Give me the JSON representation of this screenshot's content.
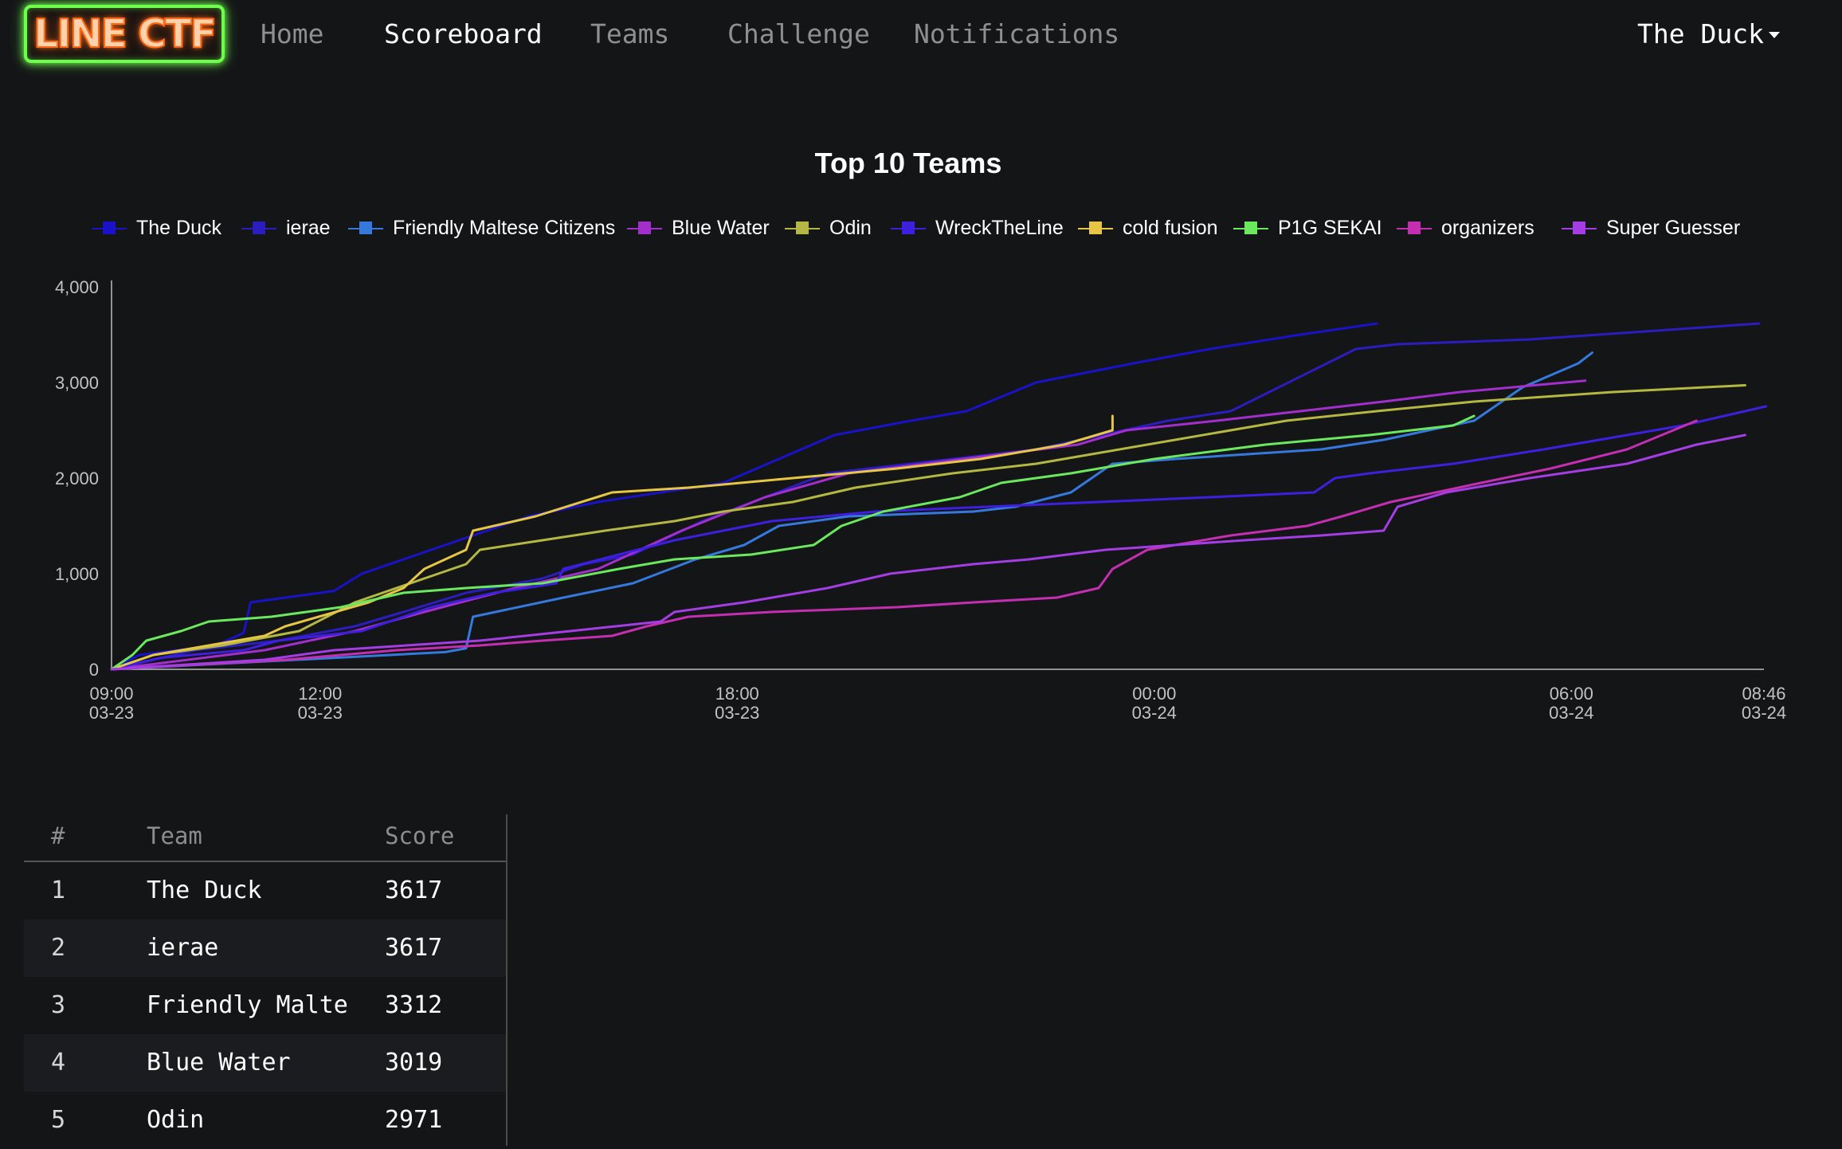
{
  "logo": {
    "text": "LINE CTF"
  },
  "nav": {
    "items": [
      {
        "label": "Home",
        "active": false
      },
      {
        "label": "Scoreboard",
        "active": true
      },
      {
        "label": "Teams",
        "active": false
      },
      {
        "label": "Challenge",
        "active": false
      },
      {
        "label": "Notifications",
        "active": false
      }
    ],
    "user": "The Duck"
  },
  "chart_data": {
    "type": "line",
    "title": "Top 10 Teams",
    "xlabel": "",
    "ylabel": "",
    "ylim": [
      0,
      4000
    ],
    "yticks": [
      "0",
      "1,000",
      "2,000",
      "3,000",
      "4,000"
    ],
    "xlim": [
      "03-23 09:00",
      "03-24 08:46"
    ],
    "xticks": [
      {
        "time": "09:00",
        "date": "03-23",
        "h": 0
      },
      {
        "time": "12:00",
        "date": "03-23",
        "h": 3
      },
      {
        "time": "18:00",
        "date": "03-23",
        "h": 9
      },
      {
        "time": "00:00",
        "date": "03-24",
        "h": 15
      },
      {
        "time": "06:00",
        "date": "03-24",
        "h": 21
      },
      {
        "time": "08:46",
        "date": "03-24",
        "h": 23.77
      }
    ],
    "legend_position": "top-center",
    "grid": false,
    "series": [
      {
        "name": "The Duck",
        "color": "#1a12c8",
        "points": [
          [
            0,
            0
          ],
          [
            0.4,
            150
          ],
          [
            1.5,
            250
          ],
          [
            1.9,
            380
          ],
          [
            2,
            700
          ],
          [
            3.2,
            820
          ],
          [
            3.6,
            1000
          ],
          [
            4.8,
            1300
          ],
          [
            6,
            1600
          ],
          [
            7,
            1750
          ],
          [
            8.8,
            1950
          ],
          [
            9.6,
            2200
          ],
          [
            10.4,
            2450
          ],
          [
            11.5,
            2600
          ],
          [
            12.3,
            2700
          ],
          [
            13.3,
            3000
          ],
          [
            14.7,
            3200
          ],
          [
            15.8,
            3350
          ],
          [
            17.1,
            3500
          ],
          [
            18.2,
            3617
          ]
        ]
      },
      {
        "name": "ierae",
        "color": "#2c1dc0",
        "points": [
          [
            0,
            0
          ],
          [
            1.2,
            200
          ],
          [
            2.4,
            300
          ],
          [
            3.5,
            450
          ],
          [
            4.2,
            600
          ],
          [
            5.1,
            800
          ],
          [
            6.2,
            950
          ],
          [
            6.8,
            1100
          ],
          [
            7.5,
            1200
          ],
          [
            8.5,
            1550
          ],
          [
            9.4,
            1800
          ],
          [
            10.3,
            2050
          ],
          [
            13.3,
            2300
          ],
          [
            15.2,
            2600
          ],
          [
            16.1,
            2700
          ],
          [
            17.9,
            3350
          ],
          [
            18.5,
            3400
          ],
          [
            20.4,
            3450
          ],
          [
            23.7,
            3617
          ]
        ]
      },
      {
        "name": "Friendly Maltese Citizens",
        "color": "#3579dc",
        "points": [
          [
            0,
            0
          ],
          [
            4.8,
            180
          ],
          [
            5.1,
            220
          ],
          [
            5.2,
            550
          ],
          [
            6.5,
            750
          ],
          [
            7.5,
            900
          ],
          [
            8.4,
            1150
          ],
          [
            9.1,
            1300
          ],
          [
            9.6,
            1500
          ],
          [
            10.6,
            1600
          ],
          [
            12.4,
            1650
          ],
          [
            13,
            1700
          ],
          [
            13.8,
            1850
          ],
          [
            14.4,
            2150
          ],
          [
            15.3,
            2200
          ],
          [
            17.4,
            2300
          ],
          [
            18.3,
            2400
          ],
          [
            19.6,
            2600
          ],
          [
            19.8,
            2700
          ],
          [
            20.3,
            2950
          ],
          [
            21.1,
            3200
          ],
          [
            21.3,
            3312
          ]
        ]
      },
      {
        "name": "Blue Water",
        "color": "#a22fcc",
        "points": [
          [
            0,
            0
          ],
          [
            2.2,
            200
          ],
          [
            3.5,
            400
          ],
          [
            4.5,
            600
          ],
          [
            5.8,
            850
          ],
          [
            7,
            1050
          ],
          [
            8.2,
            1450
          ],
          [
            9.4,
            1800
          ],
          [
            10.6,
            2050
          ],
          [
            11.7,
            2150
          ],
          [
            12.8,
            2250
          ],
          [
            13.9,
            2350
          ],
          [
            14.6,
            2500
          ],
          [
            15.9,
            2600
          ],
          [
            17.1,
            2700
          ],
          [
            18.3,
            2800
          ],
          [
            19.4,
            2900
          ],
          [
            21.2,
            3019
          ]
        ]
      },
      {
        "name": "Odin",
        "color": "#b4b842",
        "points": [
          [
            0,
            0
          ],
          [
            0.6,
            150
          ],
          [
            1.6,
            250
          ],
          [
            2.7,
            400
          ],
          [
            3.5,
            700
          ],
          [
            5.1,
            1100
          ],
          [
            5.3,
            1250
          ],
          [
            6.2,
            1350
          ],
          [
            7.1,
            1450
          ],
          [
            8.1,
            1550
          ],
          [
            8.8,
            1650
          ],
          [
            9.8,
            1750
          ],
          [
            10.7,
            1900
          ],
          [
            12.1,
            2050
          ],
          [
            13.3,
            2150
          ],
          [
            14.1,
            2250
          ],
          [
            15.3,
            2400
          ],
          [
            16.9,
            2600
          ],
          [
            18.2,
            2700
          ],
          [
            19.6,
            2800
          ],
          [
            21.6,
            2900
          ],
          [
            23.5,
            2971
          ]
        ]
      },
      {
        "name": "WreckTheLine",
        "color": "#3f1fdf",
        "points": [
          [
            0,
            0
          ],
          [
            0.7,
            120
          ],
          [
            1.9,
            200
          ],
          [
            2.4,
            300
          ],
          [
            3.6,
            400
          ],
          [
            4.6,
            650
          ],
          [
            5.5,
            800
          ],
          [
            6.4,
            900
          ],
          [
            6.5,
            1050
          ],
          [
            7.3,
            1200
          ],
          [
            8.1,
            1350
          ],
          [
            9.5,
            1550
          ],
          [
            11,
            1650
          ],
          [
            12.6,
            1700
          ],
          [
            14.2,
            1750
          ],
          [
            15.8,
            1800
          ],
          [
            17.3,
            1850
          ],
          [
            17.6,
            2000
          ],
          [
            18.1,
            2050
          ],
          [
            19.3,
            2150
          ],
          [
            20.6,
            2300
          ],
          [
            21.8,
            2450
          ],
          [
            22.6,
            2550
          ],
          [
            23.8,
            2750
          ]
        ]
      },
      {
        "name": "cold fusion",
        "color": "#e6c645",
        "points": [
          [
            0,
            0
          ],
          [
            0.6,
            150
          ],
          [
            1.4,
            250
          ],
          [
            2.2,
            350
          ],
          [
            2.5,
            450
          ],
          [
            3.7,
            700
          ],
          [
            4.2,
            850
          ],
          [
            4.5,
            1050
          ],
          [
            5.1,
            1250
          ],
          [
            5.2,
            1450
          ],
          [
            6.1,
            1600
          ],
          [
            7.2,
            1850
          ],
          [
            8.3,
            1900
          ],
          [
            9.8,
            2000
          ],
          [
            11.3,
            2100
          ],
          [
            12.5,
            2200
          ],
          [
            13.7,
            2350
          ],
          [
            14.4,
            2500
          ],
          [
            14.4,
            2650
          ]
        ]
      },
      {
        "name": "P1G SEKAI",
        "color": "#6ce85e",
        "points": [
          [
            0,
            0
          ],
          [
            0.3,
            150
          ],
          [
            0.5,
            300
          ],
          [
            1,
            400
          ],
          [
            1.4,
            500
          ],
          [
            2.3,
            550
          ],
          [
            3.3,
            650
          ],
          [
            4.2,
            800
          ],
          [
            5.1,
            850
          ],
          [
            6.2,
            900
          ],
          [
            7.3,
            1050
          ],
          [
            8.1,
            1150
          ],
          [
            9.2,
            1200
          ],
          [
            10.1,
            1300
          ],
          [
            10.5,
            1500
          ],
          [
            11.1,
            1650
          ],
          [
            12.2,
            1800
          ],
          [
            12.8,
            1950
          ],
          [
            13.8,
            2050
          ],
          [
            15,
            2200
          ],
          [
            16.6,
            2350
          ],
          [
            18.1,
            2450
          ],
          [
            19.3,
            2550
          ],
          [
            19.6,
            2650
          ]
        ]
      },
      {
        "name": "organizers",
        "color": "#c42fb2",
        "points": [
          [
            0,
            0
          ],
          [
            2.5,
            100
          ],
          [
            4.1,
            200
          ],
          [
            5.3,
            250
          ],
          [
            6.2,
            300
          ],
          [
            7.2,
            350
          ],
          [
            7.7,
            450
          ],
          [
            8.3,
            550
          ],
          [
            9.5,
            600
          ],
          [
            11.3,
            650
          ],
          [
            12.4,
            700
          ],
          [
            13.6,
            750
          ],
          [
            14.2,
            850
          ],
          [
            14.4,
            1050
          ],
          [
            14.9,
            1250
          ],
          [
            16.1,
            1400
          ],
          [
            17.2,
            1500
          ],
          [
            17.7,
            1600
          ],
          [
            18.4,
            1750
          ],
          [
            19.7,
            1950
          ],
          [
            20.7,
            2100
          ],
          [
            21.8,
            2300
          ],
          [
            22.8,
            2600
          ]
        ]
      },
      {
        "name": "Super Guesser",
        "color": "#a43de4",
        "points": [
          [
            0,
            0
          ],
          [
            2.2,
            100
          ],
          [
            3.2,
            200
          ],
          [
            5.3,
            300
          ],
          [
            6.6,
            400
          ],
          [
            7.9,
            500
          ],
          [
            8.1,
            600
          ],
          [
            9.1,
            700
          ],
          [
            10.3,
            850
          ],
          [
            11.2,
            1000
          ],
          [
            12.4,
            1100
          ],
          [
            13.2,
            1150
          ],
          [
            14.3,
            1250
          ],
          [
            15.3,
            1300
          ],
          [
            16.3,
            1350
          ],
          [
            17.4,
            1400
          ],
          [
            18.3,
            1450
          ],
          [
            18.5,
            1700
          ],
          [
            19.2,
            1850
          ],
          [
            20.4,
            2000
          ],
          [
            21.8,
            2150
          ],
          [
            22.8,
            2350
          ],
          [
            23.5,
            2450
          ]
        ]
      }
    ]
  },
  "table": {
    "headers": {
      "rank": "#",
      "team": "Team",
      "score": "Score"
    },
    "rows": [
      {
        "rank": "1",
        "team": "The Duck",
        "score": "3617"
      },
      {
        "rank": "2",
        "team": "ierae",
        "score": "3617"
      },
      {
        "rank": "3",
        "team": "Friendly Malte",
        "score": "3312"
      },
      {
        "rank": "4",
        "team": "Blue Water",
        "score": "3019"
      },
      {
        "rank": "5",
        "team": "Odin",
        "score": "2971"
      }
    ]
  }
}
